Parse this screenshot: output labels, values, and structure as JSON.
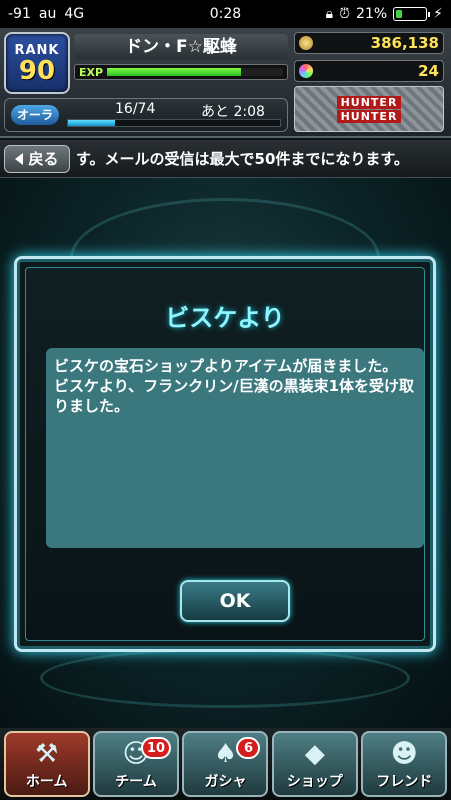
{
  "status_bar": {
    "signal": "-91",
    "carrier": "au",
    "network": "4G",
    "time": "0:28",
    "battery": "21%"
  },
  "header": {
    "rank_label": "RANK",
    "rank_value": "90",
    "player_name": "ドン・F☆駆蜂",
    "exp_label": "EXP",
    "exp_progress": 0.76,
    "aura_label": "オーラ",
    "aura_count": "16/74",
    "aura_next": "あと 2:08",
    "aura_progress": 0.22,
    "money": "386,138",
    "gems": "24",
    "logo_line1": "HUNTER",
    "logo_line2": "HUNTER"
  },
  "ticker": {
    "back_label": "戻る",
    "message": "す。メールの受信は最大で50件までになります。"
  },
  "dialog": {
    "title": "ビスケより",
    "message_lines": [
      "ビスケの宝石ショップよりアイテムが届きました。",
      "ビスケより、フランクリン/巨漢の黒装束1体を受け取りました。"
    ],
    "ok_label": "OK"
  },
  "bottom_nav": [
    {
      "label": "ホーム",
      "icon": "home-icon",
      "badge": ""
    },
    {
      "label": "チーム",
      "icon": "team-icon",
      "badge": "10"
    },
    {
      "label": "ガシャ",
      "icon": "gacha-icon",
      "badge": "6"
    },
    {
      "label": "ショップ",
      "icon": "shop-icon",
      "badge": ""
    },
    {
      "label": "フレンド",
      "icon": "friend-icon",
      "badge": ""
    }
  ],
  "colors": {
    "accent": "#8ff6ff",
    "dialog_border": "#bfe8f0",
    "message_bg": "#3a787e",
    "gold": "#ffe25a"
  }
}
